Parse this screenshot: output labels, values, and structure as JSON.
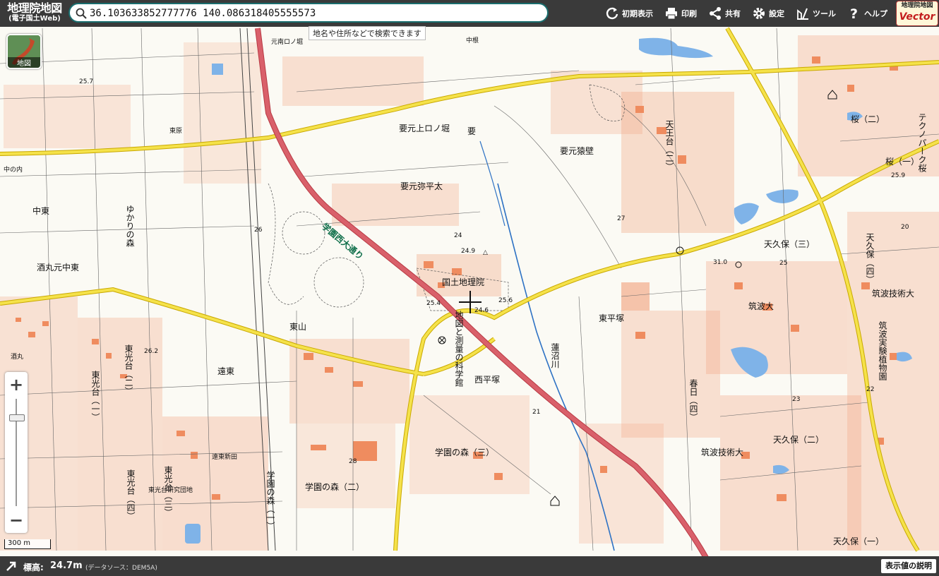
{
  "header": {
    "logo_title": "地理院地図",
    "logo_subtitle": "(電子国土Web)",
    "search_value": "36.103633852777776 140.086318405555573",
    "search_tooltip": "地名や住所などで検索できます",
    "toolbar": [
      {
        "id": "reset",
        "label": "初期表示",
        "icon": "reset-icon"
      },
      {
        "id": "print",
        "label": "印刷",
        "icon": "printer-icon"
      },
      {
        "id": "share",
        "label": "共有",
        "icon": "share-icon"
      },
      {
        "id": "settings",
        "label": "設定",
        "icon": "gear-icon"
      },
      {
        "id": "tools",
        "label": "ツール",
        "icon": "tools-icon"
      },
      {
        "id": "help",
        "label": "ヘルプ",
        "icon": "help-icon"
      }
    ],
    "vector_line1": "地理院地図",
    "vector_line2": "Vector"
  },
  "map": {
    "basemap_label": "地図",
    "zoom_in": "+",
    "zoom_out": "−",
    "scale_text": "300 m",
    "labels": {
      "kokudo": "国土地理院",
      "museum": "地図と測量の科学館",
      "kanamoto": "要元上ロノ堀",
      "kaname": "要",
      "kaname_saruhaji": "要元猿壁",
      "kaname_yataira": "要元弥平太",
      "gakuen_road": "学園西大通り",
      "tenoku3": "天久保（三）",
      "tenoku2": "天久保（二）",
      "tenoku1": "天久保（一）",
      "tenoku4": "天久保（四）",
      "tsukuba_univ": "筑波大",
      "tsukuba_tech": "筑波技術大",
      "tsukuba_tech2": "筑波技術大",
      "tsukuba_bot": "筑波実験植物園",
      "higashihiratsuka": "東平塚",
      "nishihiratsuka": "西平塚",
      "gakuen3": "学園の森（三）",
      "gakuen2": "学園の森（二）",
      "gakuen1": "学園の森（一）",
      "higashiyama": "東山",
      "endo": "遠東",
      "higashikoudai2": "東光台（二）",
      "higashikoudai1": "東光台（一）",
      "higashikoudai4": "東光台（四）",
      "higashikoudai3": "東光台（三）",
      "higashikoudai_ken": "東光台研究団地",
      "yukarinomori": "ゆかりの森",
      "sakamaru": "酒丸元中東",
      "nakahigashi": "中東",
      "sakura2": "桜（二）",
      "sakura1": "桜（一）",
      "technopark": "テクノパーク桜",
      "tenno": "天王台（二）",
      "kasuga4": "春日（四）",
      "kasuga": "春日",
      "renuma": "蓮沼川",
      "naka": "中の内",
      "higashihara": "東原",
      "nakane": "中根",
      "endonitta": "遠東新田",
      "minami": "元南ロノ堀",
      "saka": "酒丸"
    },
    "spot_heights": [
      "24.9",
      "25.4",
      "24.6",
      "25.6",
      "31.0",
      "25",
      "26",
      "27",
      "21",
      "23",
      "28",
      "26.2",
      "22",
      "20",
      "25.9",
      "25.7",
      "24"
    ]
  },
  "footer": {
    "elevation_label": "標高:",
    "elevation_value": "24.7m",
    "elevation_source": "(データソース：DEM5A)",
    "explain_button": "表示値の説明"
  },
  "colors": {
    "bar": "#3a3a3a",
    "search_border": "#1a6d6d",
    "road_yellow": "#f2de3a",
    "road_red": "#d9606a",
    "building": "#f2a27e",
    "water": "#7fb3e8"
  }
}
